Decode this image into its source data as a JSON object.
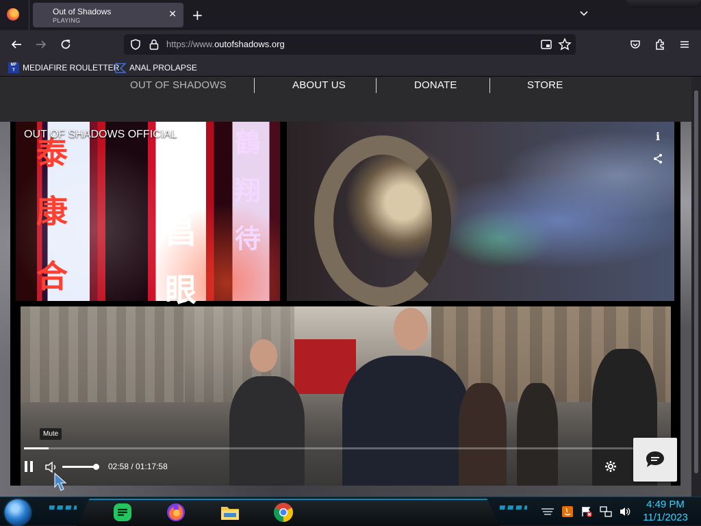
{
  "browser": {
    "tab": {
      "title": "Out of Shadows",
      "status": "PLAYING"
    },
    "url": {
      "prefix": "https://www.",
      "domain": "outofshadows.org"
    },
    "bookmarks": [
      {
        "label": "MEDIAFIRE ROULETTER",
        "icon": "mediafire-icon"
      },
      {
        "label": "ANAL PROLAPSE",
        "icon": "bookmark-flag-icon"
      }
    ]
  },
  "site": {
    "nav": [
      {
        "label": "OUT OF SHADOWS"
      },
      {
        "label": "ABOUT US"
      },
      {
        "label": "DONATE"
      },
      {
        "label": "STORE"
      }
    ]
  },
  "player": {
    "channel_title": "OUT OF SHADOWS OFFICIAL",
    "tooltip": "Mute",
    "time": "02:58 / 01:17:58",
    "progress": 0.038,
    "volume": 0.9,
    "hanzi": [
      "泰",
      "康",
      "合",
      "茂",
      "昌",
      "眼",
      "鶴",
      "翔",
      "待"
    ]
  },
  "taskbar": {
    "clock_time": "4:49 PM",
    "clock_date": "11/1/2023",
    "apps": [
      "notes-app-icon",
      "firefox-icon",
      "file-explorer-icon",
      "chrome-icon"
    ]
  },
  "colors": {
    "accent": "#2fd7ff",
    "browser_bg": "#2b2a33",
    "site_nav_bg": "#2b2b2e"
  }
}
